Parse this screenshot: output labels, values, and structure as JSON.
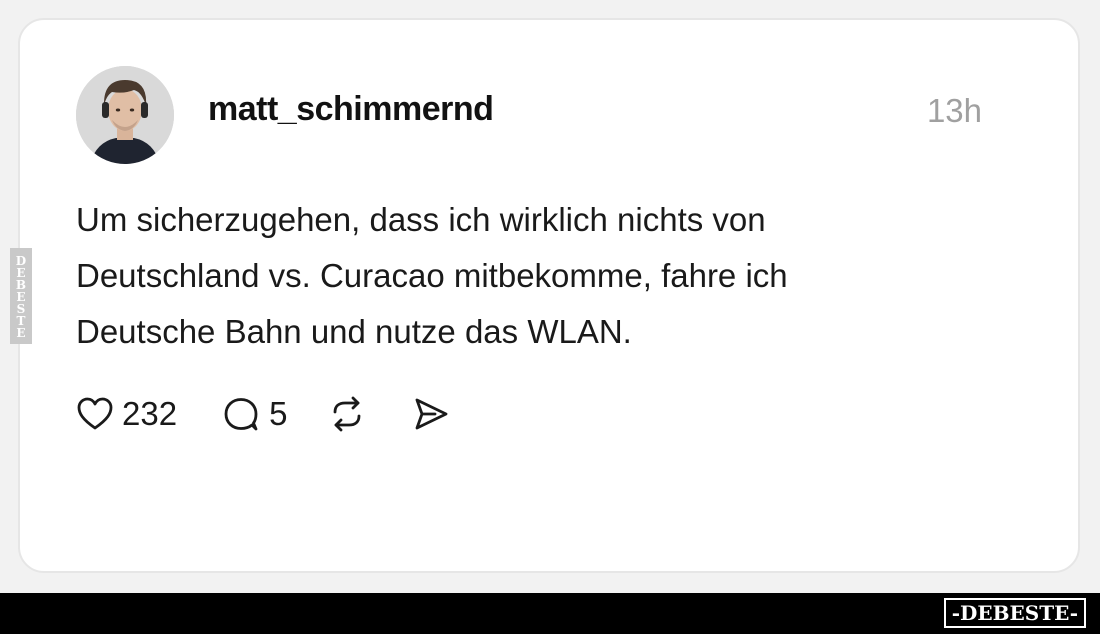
{
  "post": {
    "username": "matt_schimmernd",
    "timestamp": "13h",
    "text_lines": [
      "Um sicherzugehen, dass ich wirklich nichts von",
      "Deutschland vs. Curacao mitbekomme, fahre ich",
      "Deutsche Bahn und nutze das WLAN."
    ],
    "actions": {
      "likes": "232",
      "replies": "5"
    },
    "icons": {
      "like": "heart-icon",
      "reply": "speech-bubble-icon",
      "repost": "repost-icon",
      "share": "send-icon"
    }
  },
  "watermarks": {
    "side": "DEBESTE",
    "bottom": "-DEBESTE-"
  },
  "colors": {
    "text": "#1a1a1a",
    "username": "#121212",
    "timestamp": "#a0a0a0",
    "card_border": "#e6e6e6",
    "bottom_bar": "#000000"
  }
}
